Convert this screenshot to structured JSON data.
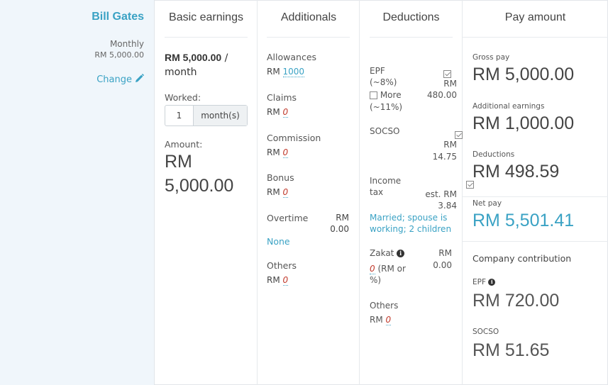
{
  "employee": {
    "name": "Bill Gates",
    "period": "Monthly",
    "salary": "RM 5,000.00",
    "change_label": "Change",
    "icon": "pencil-icon"
  },
  "headers": {
    "basic": "Basic earnings",
    "additionals": "Additionals",
    "deductions": "Deductions",
    "pay": "Pay amount"
  },
  "basic": {
    "rate": "RM 5,000.00",
    "rate_suffix": " /",
    "per": "month",
    "worked_label": "Worked:",
    "worked_value": "1",
    "worked_unit": "month(s)",
    "amount_label": "Amount:",
    "amount_rm": "RM",
    "amount_value": "5,000.00"
  },
  "additionals": {
    "allowances_label": "Allowances",
    "allowances_value": "1000",
    "claims_label": "Claims",
    "commission_label": "Commission",
    "bonus_label": "Bonus",
    "overtime_label": "Overtime",
    "overtime_rm": "RM",
    "overtime_value": "0.00",
    "overtime_none": "None",
    "others_label": "Others",
    "rm": "RM",
    "zero": "0"
  },
  "deductions": {
    "epf_label": "EPF",
    "epf_rate": "(~8%)",
    "epf_rm": "RM",
    "epf_value": "480.00",
    "more_label": "More",
    "more_rate": "(~11%)",
    "socso_label": "SOCSO",
    "socso_rm": "RM",
    "socso_value": "14.75",
    "income_label_1": "Income",
    "income_label_2": "tax",
    "income_est": "est. RM",
    "income_value": "3.84",
    "income_note_1": "Married; spouse is",
    "income_note_2": "working; 2 children",
    "zakat_label": "Zakat",
    "zakat_rm": "RM",
    "zakat_value": "0.00",
    "zakat_input": "0",
    "zakat_suffix": " (RM or",
    "zakat_suffix2": "%)",
    "others_label": "Others",
    "rm": "RM",
    "zero": "0"
  },
  "pay": {
    "gross_label": "Gross pay",
    "gross_value": "RM 5,000.00",
    "additional_label": "Additional earnings",
    "additional_value": "RM 1,000.00",
    "deductions_label": "Deductions",
    "deductions_value": "RM 498.59",
    "net_label": "Net pay",
    "net_value": "RM 5,501.41",
    "company_label": "Company contribution",
    "epf_label": "EPF",
    "epf_value": "RM 720.00",
    "socso_label": "SOCSO",
    "socso_value": "RM 51.65"
  },
  "colors": {
    "accent": "#3aa2c4",
    "zero": "#c0392b",
    "panel": "#f0f6fb"
  }
}
